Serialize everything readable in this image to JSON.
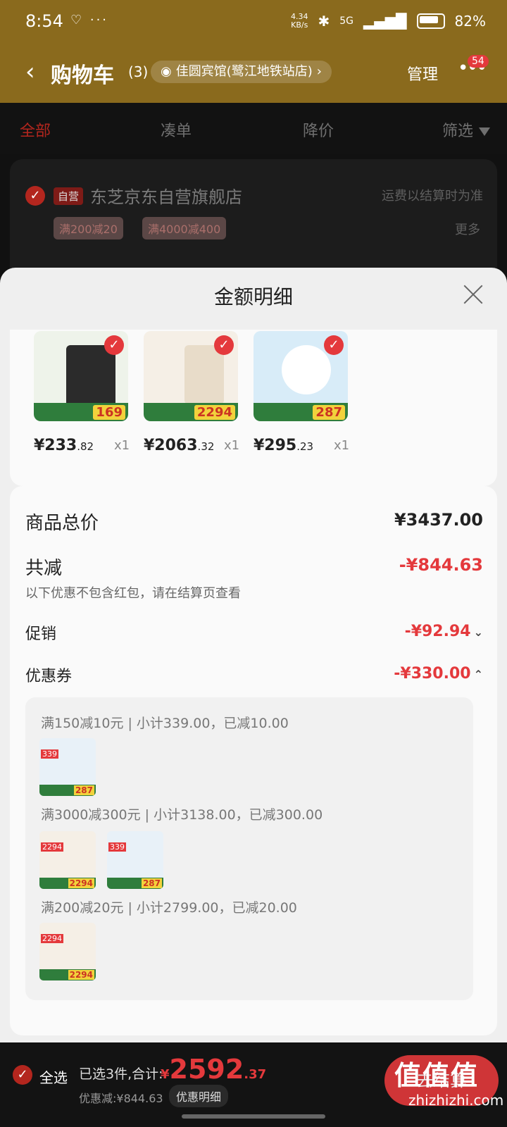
{
  "status": {
    "time": "8:54",
    "dots": "♡ ···",
    "speed_top": "4.34",
    "speed_unit": "KB/s",
    "net": "5G",
    "battery": "82%"
  },
  "header": {
    "title": "购物车",
    "count": "(3)",
    "address": "佳圆宾馆(鹭江地铁站店)",
    "manage": "管理",
    "badge": "54"
  },
  "tabs": [
    "全部",
    "凑单",
    "降价",
    "筛选"
  ],
  "store": {
    "self_tag": "自营",
    "name": "东芝京东自营旗舰店",
    "shipping": "运费以结算时为准",
    "promos": [
      "满200减20",
      "满4000减400"
    ],
    "more": "更多"
  },
  "sheet": {
    "title": "金额明细",
    "products": [
      {
        "price_main": "¥233",
        "price_dec": ".82",
        "qty": "x1",
        "badge": "169",
        "color": "#2b2b2b"
      },
      {
        "price_main": "¥2063",
        "price_dec": ".32",
        "qty": "x1",
        "badge": "2294",
        "color": "#d9b991"
      },
      {
        "price_main": "¥295",
        "price_dec": ".23",
        "qty": "x1",
        "badge": "287",
        "color": "#cfe4f3"
      }
    ],
    "total_label": "商品总价",
    "total_value": "¥3437.00",
    "reduce_label": "共减",
    "reduce_value": "-¥844.63",
    "reduce_note": "以下优惠不包含红包，请在结算页查看",
    "promo_label": "促销",
    "promo_value": "-¥92.94",
    "coupon_label": "优惠券",
    "coupon_value": "-¥330.00",
    "coupons": [
      {
        "text": "满150减10元 | 小计339.00，已减10.00",
        "thumbs": [
          "287"
        ]
      },
      {
        "text": "满3000减300元 | 小计3138.00，已减300.00",
        "thumbs": [
          "2294",
          "287"
        ]
      },
      {
        "text": "满200减20元 | 小计2799.00，已减20.00",
        "thumbs": [
          "2294"
        ]
      }
    ]
  },
  "bottom": {
    "select_all": "全选",
    "summary": "已选3件,合计:",
    "currency": "¥",
    "price_main": "2592",
    "price_dec": ".37",
    "saved": "优惠减:¥844.63",
    "detail_button": "优惠明细",
    "checkout": "去结算",
    "watermark": "值值值",
    "watermark_url": "zhizhizhi.com"
  },
  "colors": {
    "accent": "#e4393c",
    "header_bg": "#8a6a1d",
    "sheet_bg": "#efefef"
  }
}
